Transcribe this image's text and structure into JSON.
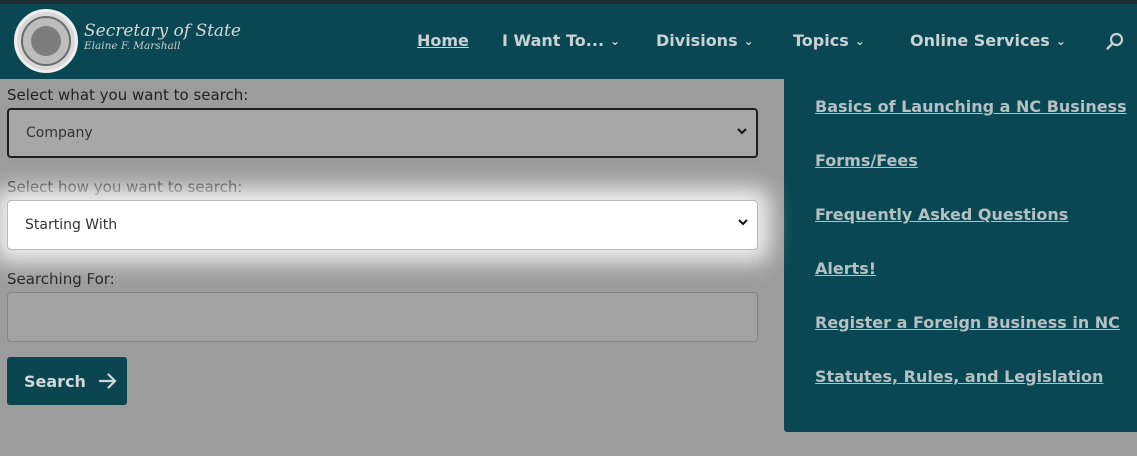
{
  "brand": {
    "title": "Secretary of State",
    "subtitle": "Elaine F. Marshall"
  },
  "nav": {
    "home": "Home",
    "i_want_to": "I Want To...",
    "divisions": "Divisions",
    "topics": "Topics",
    "online_services": "Online Services",
    "search_icon": "search-icon",
    "chevron_icon": "chevron-down-icon"
  },
  "form": {
    "what_label": "Select what you want to search:",
    "what_value": "Company",
    "how_label": "Select how you want to search:",
    "how_value": "Starting With",
    "for_label": "Searching For:",
    "for_value": "",
    "search_button": "Search",
    "arrow_icon": "arrow-right-icon"
  },
  "dropdown": {
    "items": [
      "Basics of Launching a NC Business",
      "Forms/Fees",
      "Frequently Asked Questions",
      "Alerts!",
      "Register a Foreign Business in NC",
      "Statutes, Rules, and Legislation"
    ]
  },
  "colors": {
    "header_bg": "#0b4752",
    "overlay_bg": "#9c9c9c",
    "highlight": "#ffffff"
  }
}
